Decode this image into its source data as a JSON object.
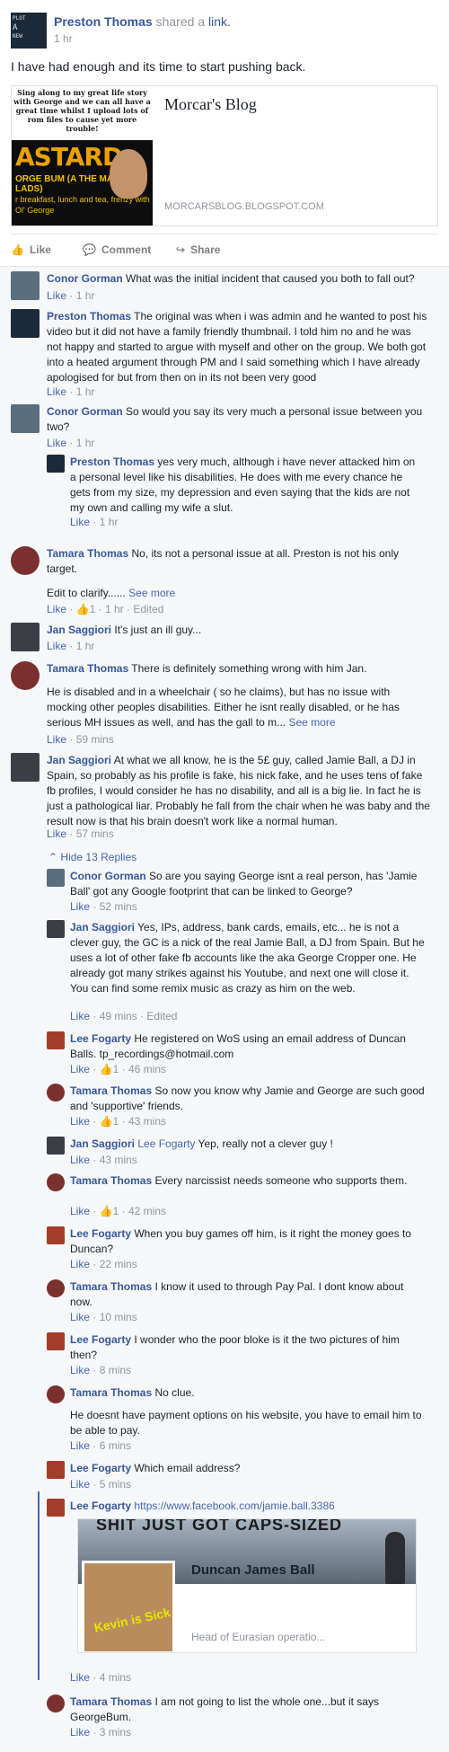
{
  "post": {
    "author": "Preston Thomas",
    "shared_text": "shared a",
    "link_text": "link.",
    "time": "1 hr",
    "avatar_lines": [
      "PLOT",
      "A",
      "NEW"
    ],
    "text": "I have had enough and its time to start pushing back.",
    "card": {
      "title": "Morcar's Blog",
      "domain": "MORCARSBLOG.BLOGSPOT.COM",
      "image_top": "Sing along to my great life story with George and we can all have a great time whilst I upload lots of rom files to cause yet more trouble!",
      "image_big": "ASTARD",
      "image_sub": "ORGE BUM (A THE MACC LADS)",
      "image_bottom": "r breakfast, lunch and tea, frenzy with Ol' George"
    },
    "actions": {
      "like": "Like",
      "comment": "Comment",
      "share": "Share"
    }
  },
  "comments": [
    {
      "author": "Conor Gorman",
      "text": "What was the initial incident that caused you both to fall out?",
      "like": "Like",
      "time": "1 hr"
    },
    {
      "author": "Preston Thomas",
      "text": "The original was when i was admin and he wanted to post his video but it did not have a family friendly thumbnail. I told him no and he was not happy and started to argue with myself and other on the group. We both got into a heated argument through PM and I said something which I have already apologised for but from then on in its not been very good",
      "like": "Like",
      "time": "1 hr"
    },
    {
      "author": "Conor Gorman",
      "text": "So would you say its very much a personal issue between you two?",
      "like": "Like",
      "time": "1 hr"
    },
    {
      "author": "Preston Thomas",
      "text": "yes very much, although i have never attacked him on a personal level like his disabilities. He does with me every chance he gets from my size, my depression and even saying that the kids are not my own and calling my wife a slut.",
      "like": "Like",
      "time": "1 hr"
    },
    {
      "author": "Tamara Thomas",
      "text": "No, its not a personal issue at all. Preston is not his only target.",
      "text2": "Edit to clarify......",
      "see_more": "See more",
      "like": "Like",
      "reactions": "1",
      "time": "1 hr",
      "edited": "Edited"
    },
    {
      "author": "Jan Saggiori",
      "text": "It's just an ill guy...",
      "like": "Like",
      "time": "1 hr"
    },
    {
      "author": "Tamara Thomas",
      "text": "There is definitely something wrong with him Jan.",
      "text2": "He is disabled and in a wheelchair ( so he claims), but has no issue with mocking other peoples disabilities. Either he isnt really disabled, or he has serious MH issues as well, and has the gall to m...",
      "see_more": "See more",
      "like": "Like",
      "time": "59 mins"
    },
    {
      "author": "Jan Saggiori",
      "text": "At what we all know, he is the 5£ guy, called Jamie Ball, a DJ in Spain, so probably as his profile is fake, his nick fake, and he uses tens of fake fb profiles, I would consider he has no disability, and all is a big lie. In fact he is just a pathological liar. Probably he fall from the chair when he was baby and the result now is that his brain doesn't work like a normal human.",
      "like": "Like",
      "time": "57 mins"
    }
  ],
  "hide_replies": "Hide 13 Replies",
  "replies": [
    {
      "author": "Conor Gorman",
      "text": "So are you saying George isnt a real person, has 'Jamie Ball' got any Google footprint that can be linked to George?",
      "like": "Like",
      "time": "52 mins"
    },
    {
      "author": "Jan Saggiori",
      "text": "Yes, IPs, address, bank cards, emails, etc... he is not a clever guy, the GC is a nick of the real Jamie Ball, a DJ from Spain. But he uses a lot of other fake fb accounts like the aka George Cropper one. He already got many strikes against his Youtube, and next one will close it. You can find some remix music as crazy as him on the web.",
      "like": "Like",
      "time": "49 mins",
      "edited": "Edited"
    },
    {
      "author": "Lee Fogarty",
      "text": "He registered on WoS using an email address of Duncan Balls. tp_recordings@hotmail.com",
      "like": "Like",
      "reactions": "1",
      "time": "46 mins"
    },
    {
      "author": "Tamara Thomas",
      "text": "So now you know why Jamie and George are such good and 'supportive' friends.",
      "like": "Like",
      "reactions": "1",
      "time": "43 mins"
    },
    {
      "author": "Jan Saggiori",
      "mention": "Lee Fogarty",
      "text": "Yep, really not a clever guy !",
      "like": "Like",
      "time": "43 mins"
    },
    {
      "author": "Tamara Thomas",
      "text": "Every narcissist needs someone who supports them.",
      "like": "Like",
      "reactions": "1",
      "time": "42 mins"
    },
    {
      "author": "Lee Fogarty",
      "text": "When you buy games off him, is it right the money goes to Duncan?",
      "like": "Like",
      "time": "22 mins"
    },
    {
      "author": "Tamara Thomas",
      "text": "I know it used to through Pay Pal. I dont know about now.",
      "like": "Like",
      "time": "10 mins"
    },
    {
      "author": "Lee Fogarty",
      "text": "I wonder who the poor bloke is it the two pictures of him then?",
      "like": "Like",
      "time": "8 mins"
    },
    {
      "author": "Tamara Thomas",
      "text": "No clue.",
      "text2": "He doesnt have payment options on his website, you have to email him to be able to pay.",
      "like": "Like",
      "time": "6 mins"
    },
    {
      "author": "Lee Fogarty",
      "text": "Which email address?",
      "like": "Like",
      "time": "5 mins"
    },
    {
      "author": "Lee Fogarty",
      "url": "https://www.facebook.com/jamie.ball.3386",
      "preview": {
        "cover_text": "SHIT JUST GOT CAPS-SIZED",
        "name": "Duncan James Ball",
        "desc": "Head of Eurasian operatio...",
        "pfp_text": "Kevin is Sick"
      },
      "like": "Like",
      "time": "4 mins"
    },
    {
      "author": "Tamara Thomas",
      "text": "I am not going to list the whole one...but it says GeorgeBum.",
      "like": "Like",
      "time": "3 mins"
    }
  ],
  "colors": {
    "link_blue": "#365899",
    "action_blue": "#4267b2",
    "meta_gray": "#90949c",
    "bg": "#f6f7f9"
  }
}
